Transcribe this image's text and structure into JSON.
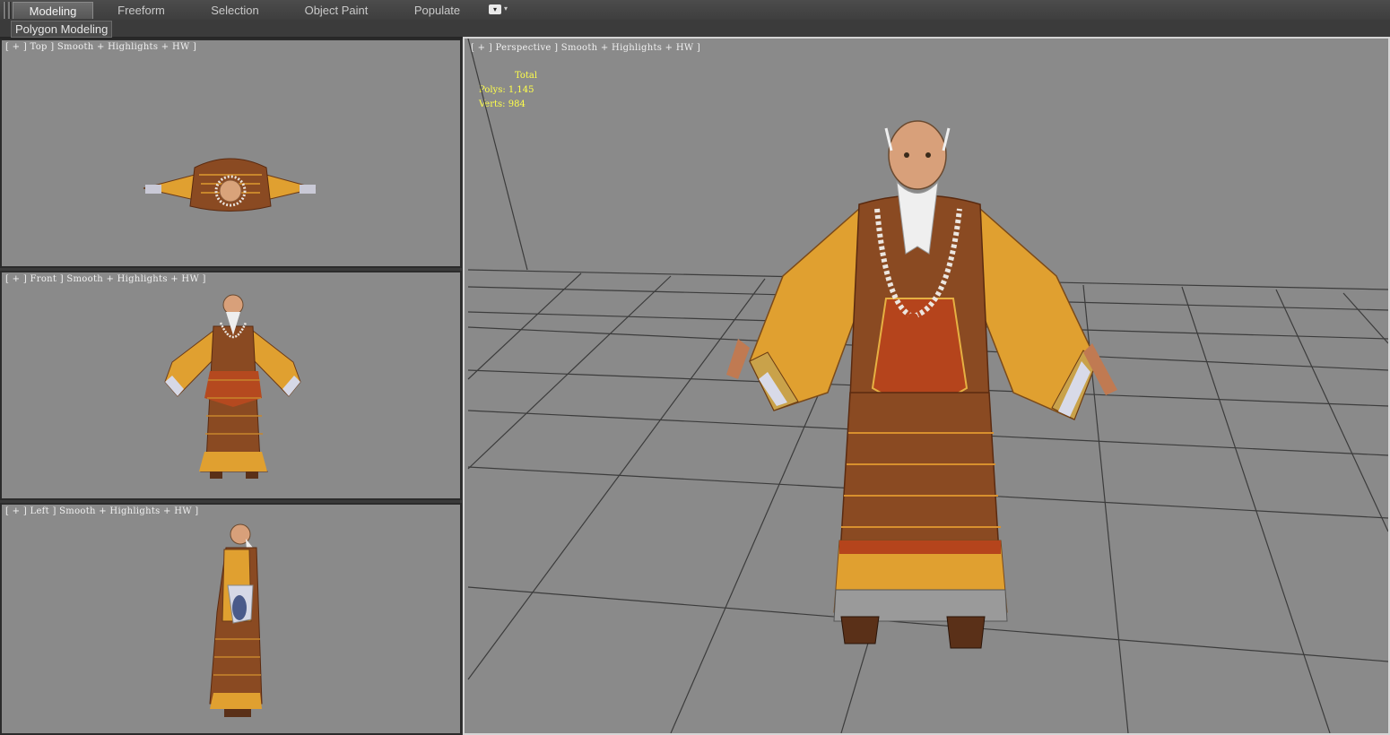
{
  "ribbon": {
    "tabs": [
      {
        "label": "Modeling",
        "active": true
      },
      {
        "label": "Freeform",
        "active": false
      },
      {
        "label": "Selection",
        "active": false
      },
      {
        "label": "Object Paint",
        "active": false
      },
      {
        "label": "Populate",
        "active": false
      }
    ],
    "panel_label": "Polygon Modeling"
  },
  "viewports": {
    "top": {
      "label": "[ + ] Top ] Smooth + Highlights + HW ]"
    },
    "front": {
      "label": "[ + ] Front ] Smooth + Highlights + HW ]"
    },
    "left": {
      "label": "[ + ] Left ] Smooth + Highlights + HW ]"
    },
    "perspective": {
      "label": "[ + ] Perspective ] Smooth + Highlights + HW ]",
      "stats": {
        "header": "Total",
        "polys_label": "Polys:",
        "polys_value": "1,145",
        "verts_label": "Verts:",
        "verts_value": "984"
      }
    }
  },
  "colors": {
    "viewport_bg": "#8a8a8a",
    "active_border": "#d5d5d5",
    "stats_text": "#ffff4a",
    "robe_orange": "#e0a030",
    "robe_brown": "#8a4a22",
    "grid_line": "#3c3c3c"
  },
  "icons": {
    "ribbon_options": "ribbon-options-icon",
    "model": "monk-character-model"
  }
}
